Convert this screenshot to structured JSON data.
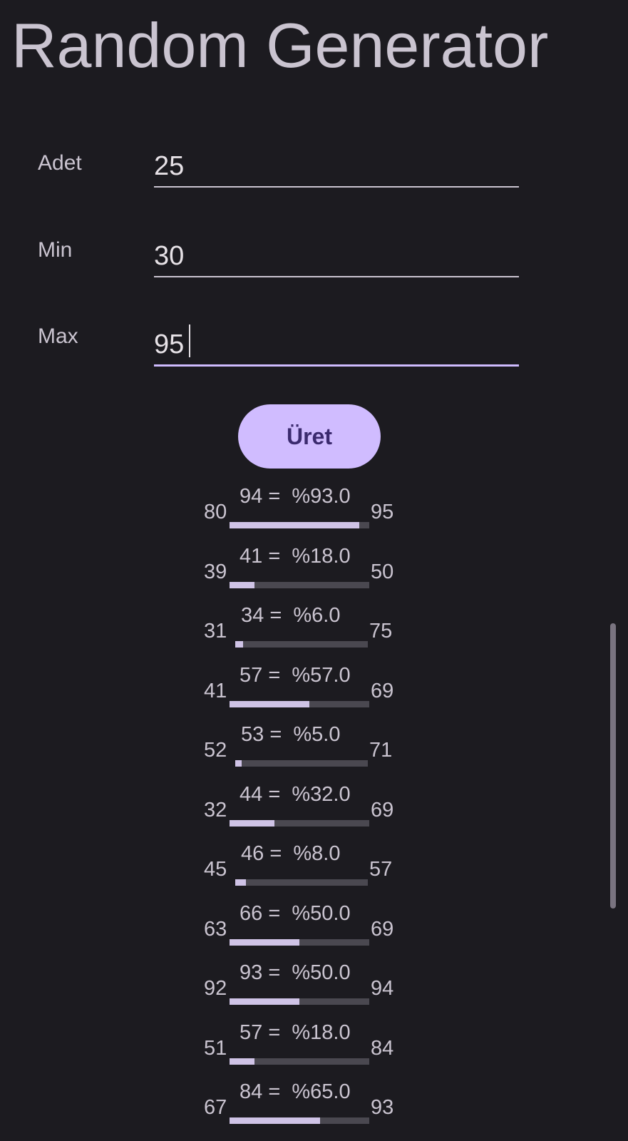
{
  "app": {
    "title": "Random Generator"
  },
  "form": {
    "count": {
      "label": "Adet",
      "value": "25"
    },
    "min": {
      "label": "Min",
      "value": "30"
    },
    "max": {
      "label": "Max",
      "value": "95"
    },
    "generate_label": "Üret"
  },
  "results": [
    {
      "min": "80",
      "value": "94",
      "percent": "%93.0",
      "max": "95",
      "fraction": 0.93
    },
    {
      "min": "39",
      "value": "41",
      "percent": "%18.0",
      "max": "50",
      "fraction": 0.18
    },
    {
      "min": "31",
      "value": "34",
      "percent": "%6.0",
      "max": "75",
      "fraction": 0.06
    },
    {
      "min": "41",
      "value": "57",
      "percent": "%57.0",
      "max": "69",
      "fraction": 0.57
    },
    {
      "min": "52",
      "value": "53",
      "percent": "%5.0",
      "max": "71",
      "fraction": 0.05
    },
    {
      "min": "32",
      "value": "44",
      "percent": "%32.0",
      "max": "69",
      "fraction": 0.32
    },
    {
      "min": "45",
      "value": "46",
      "percent": "%8.0",
      "max": "57",
      "fraction": 0.08
    },
    {
      "min": "63",
      "value": "66",
      "percent": "%50.0",
      "max": "69",
      "fraction": 0.5
    },
    {
      "min": "92",
      "value": "93",
      "percent": "%50.0",
      "max": "94",
      "fraction": 0.5
    },
    {
      "min": "51",
      "value": "57",
      "percent": "%18.0",
      "max": "84",
      "fraction": 0.18
    },
    {
      "min": "67",
      "value": "84",
      "percent": "%65.0",
      "max": "93",
      "fraction": 0.65
    }
  ],
  "colors": {
    "background": "#1c1b20",
    "text": "#cac4d0",
    "accent": "#d0bcff",
    "button_text": "#3b2a6e",
    "bar_track": "#4a4850",
    "bar_fill": "#cfc3e6"
  }
}
